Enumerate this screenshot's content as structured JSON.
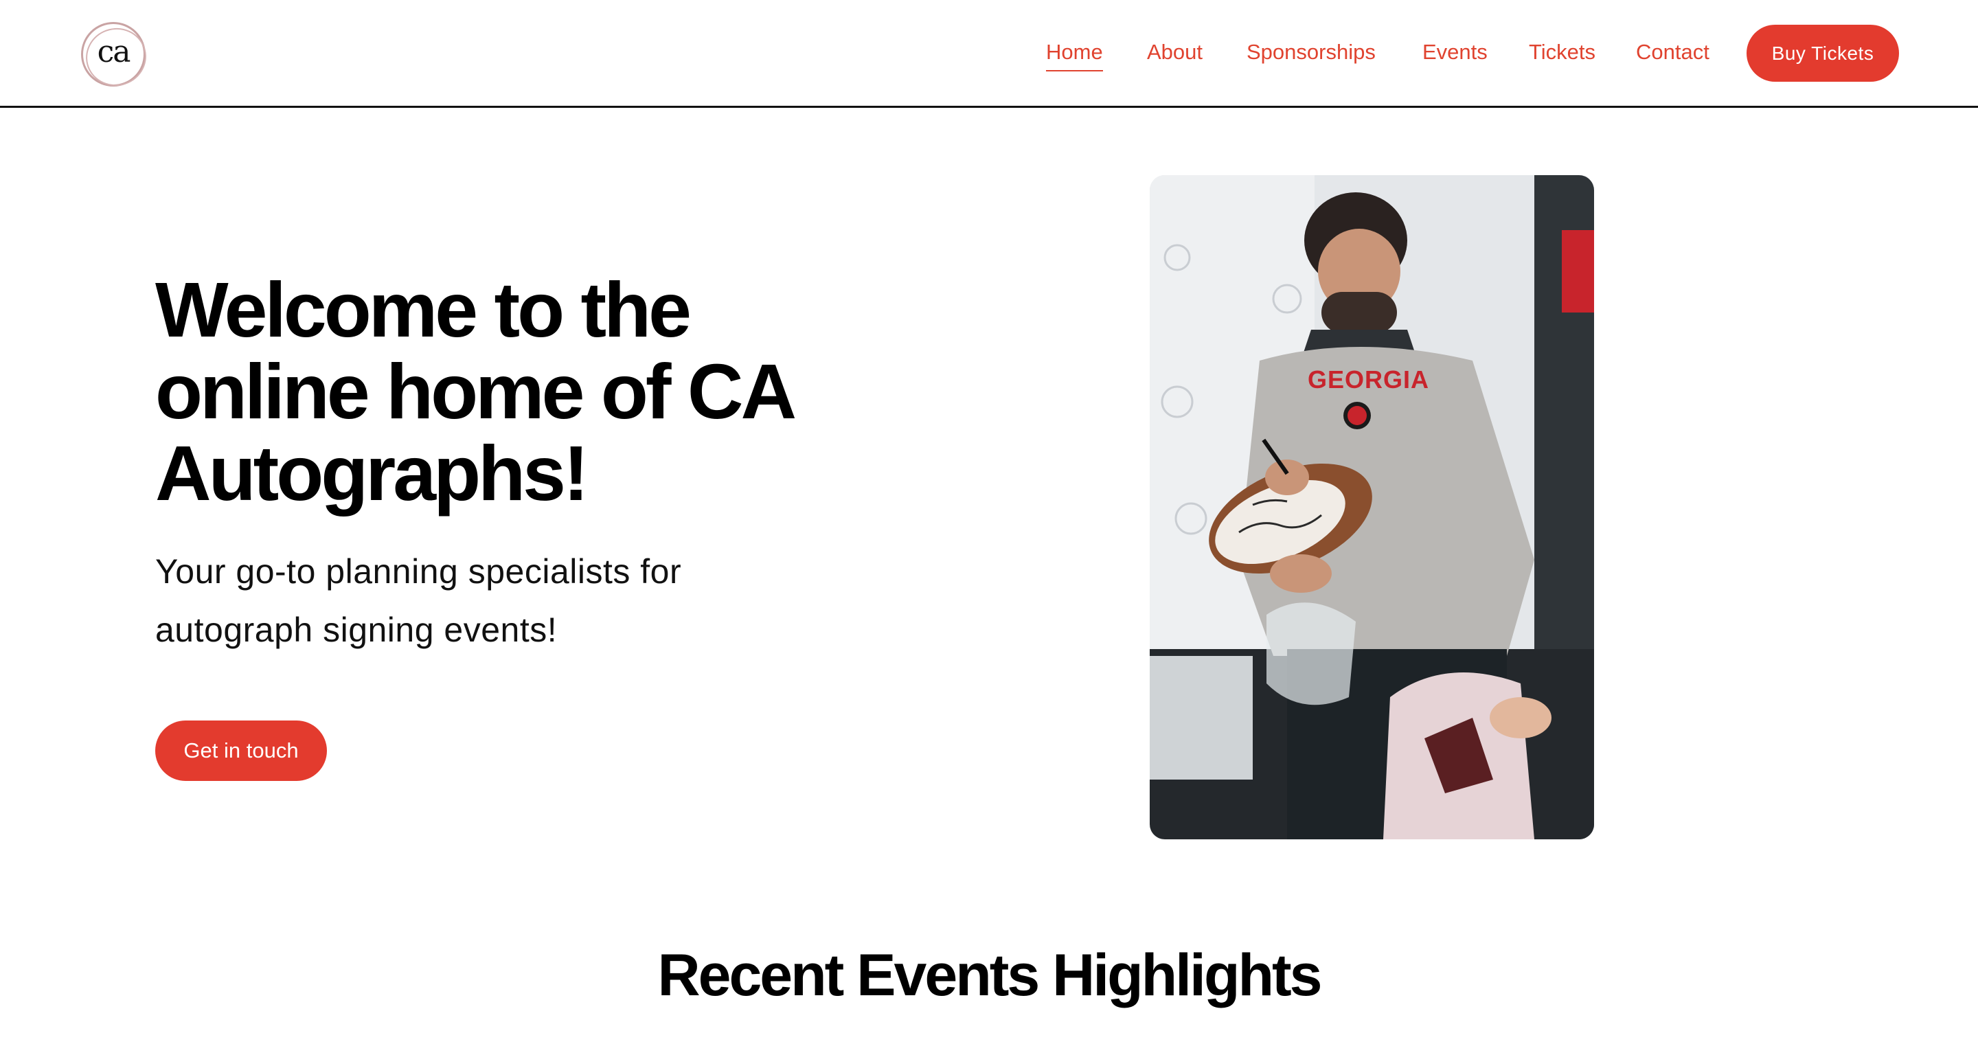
{
  "logo": {
    "text": "ca",
    "icon": "ca-autographs-logo"
  },
  "nav": {
    "items": [
      {
        "label": "Home",
        "active": true
      },
      {
        "label": "About",
        "active": false
      },
      {
        "label": "Sponsorships",
        "active": false
      },
      {
        "label": "Events",
        "active": false
      },
      {
        "label": "Tickets",
        "active": false
      },
      {
        "label": "Contact",
        "active": false
      }
    ],
    "buy_label": "Buy Tickets"
  },
  "hero": {
    "title": "Welcome to the online home of CA Autographs!",
    "subtitle": "Your go-to planning specialists for autograph signing events!",
    "cta_label": "Get in touch",
    "photo_icon": "autograph-signing-photo"
  },
  "section": {
    "title": "Recent Events Highlights"
  },
  "colors": {
    "accent": "#e33b2e",
    "nav_text": "#e0432f",
    "text": "#000000",
    "background": "#ffffff"
  }
}
